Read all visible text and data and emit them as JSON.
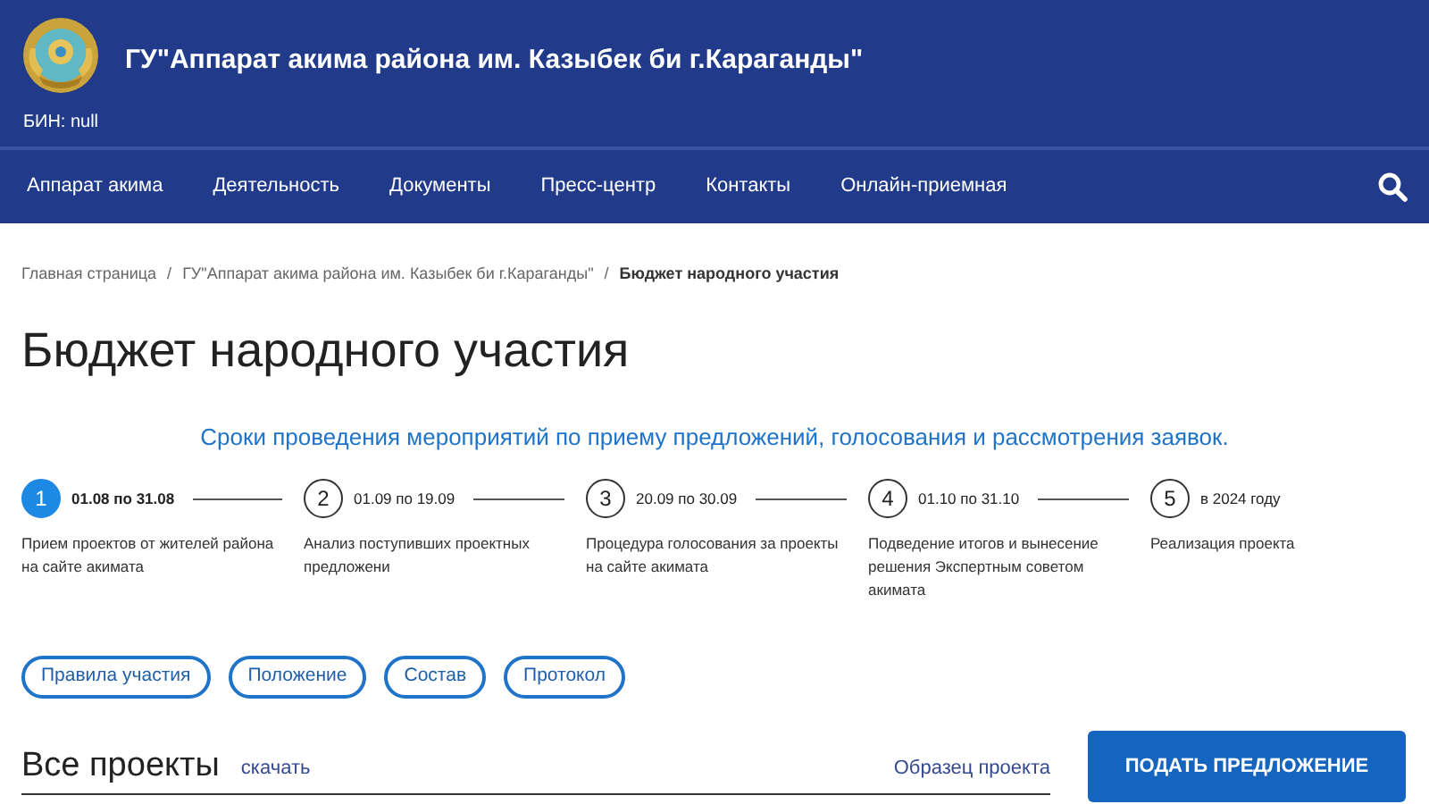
{
  "header": {
    "title": "ГУ\"Аппарат акима района им. Казыбек би г.Караганды\"",
    "bin": "БИН: null"
  },
  "nav": {
    "items": [
      {
        "label": "Аппарат акима"
      },
      {
        "label": "Деятельность"
      },
      {
        "label": "Документы"
      },
      {
        "label": "Пресс-центр"
      },
      {
        "label": "Контакты"
      },
      {
        "label": "Онлайн-приемная"
      }
    ]
  },
  "breadcrumbs": [
    {
      "label": "Главная страница",
      "current": false
    },
    {
      "separator": "/",
      "label": "ГУ\"Аппарат акима района им. Казыбек би г.Караганды\"",
      "current": false
    },
    {
      "separator": "/",
      "label": "Бюджет народного участия",
      "current": true
    }
  ],
  "page_title": "Бюджет народного участия",
  "timeline": {
    "heading": "Сроки проведения мероприятий по приему предложений, голосования и рассмотрения заявок.",
    "steps": [
      {
        "number": "1",
        "dates": "01.08 по 31.08",
        "text": "Прием проектов от жителей района на сайте акимата",
        "selected": true
      },
      {
        "number": "2",
        "dates": "01.09 по 19.09",
        "text": "Анализ поступивших проектных предложени",
        "selected": false
      },
      {
        "number": "3",
        "dates": "20.09 по 30.09",
        "text": "Процедура голосования за проекты на сайте акимата",
        "selected": false
      },
      {
        "number": "4",
        "dates": "01.10 по 31.10",
        "text": "Подведение итогов и вынесение решения Экспертным советом акимата",
        "selected": false
      },
      {
        "number": "5",
        "dates": "в 2024 году",
        "text": "Реализация проекта",
        "selected": false
      }
    ]
  },
  "doc_buttons": [
    "Правила участия",
    "Положение",
    "Состав",
    "Протокол"
  ],
  "projects": {
    "heading": "Все проекты",
    "download": "скачать",
    "sample": "Образец проекта",
    "submit": "ПОДАТЬ ПРЕДЛОЖЕНИЕ"
  }
}
